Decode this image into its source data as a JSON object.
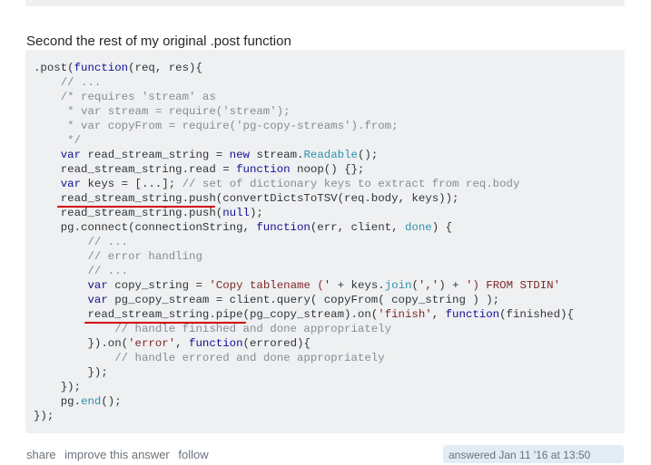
{
  "intro_text": "Second the rest of my original .post function",
  "code_lines": [
    [
      {
        "t": ".post(",
        "c": "p"
      },
      {
        "t": "function",
        "c": "kw"
      },
      {
        "t": "(req, res){",
        "c": "p"
      }
    ],
    [
      {
        "t": "    ",
        "c": "p"
      },
      {
        "t": "// ...",
        "c": "com"
      }
    ],
    [
      {
        "t": "    ",
        "c": "p"
      },
      {
        "t": "/* requires 'stream' as",
        "c": "com"
      }
    ],
    [
      {
        "t": "     * var stream = require('stream');",
        "c": "com"
      }
    ],
    [
      {
        "t": "     * var copyFrom = require('pg-copy-streams').from;",
        "c": "com"
      }
    ],
    [
      {
        "t": "     */",
        "c": "com"
      }
    ],
    [
      {
        "t": "    ",
        "c": "p"
      },
      {
        "t": "var",
        "c": "kw"
      },
      {
        "t": " read_stream_string = ",
        "c": "p"
      },
      {
        "t": "new",
        "c": "kw"
      },
      {
        "t": " stream.",
        "c": "p"
      },
      {
        "t": "Readable",
        "c": "ty"
      },
      {
        "t": "();",
        "c": "p"
      }
    ],
    [
      {
        "t": "    read_stream_string.read = ",
        "c": "p"
      },
      {
        "t": "function",
        "c": "kw"
      },
      {
        "t": " noop() {};",
        "c": "p"
      }
    ],
    [
      {
        "t": "    ",
        "c": "p"
      },
      {
        "t": "var",
        "c": "kw"
      },
      {
        "t": " keys = [...]; ",
        "c": "p"
      },
      {
        "t": "// set of dictionary keys to extract from req.body",
        "c": "com"
      }
    ],
    [
      {
        "t": "    read_stream_string.push(convertDictsToTSV(req.body, keys));",
        "c": "p"
      }
    ],
    [
      {
        "t": "    read_stream_string.push(",
        "c": "p"
      },
      {
        "t": "null",
        "c": "kw"
      },
      {
        "t": ");",
        "c": "p"
      }
    ],
    [
      {
        "t": "    pg.connect(connectionString, ",
        "c": "p"
      },
      {
        "t": "function",
        "c": "kw"
      },
      {
        "t": "(err, client, ",
        "c": "p"
      },
      {
        "t": "done",
        "c": "fn"
      },
      {
        "t": ") {",
        "c": "p"
      }
    ],
    [
      {
        "t": "        ",
        "c": "p"
      },
      {
        "t": "// ...",
        "c": "com"
      }
    ],
    [
      {
        "t": "        ",
        "c": "p"
      },
      {
        "t": "// error handling",
        "c": "com"
      }
    ],
    [
      {
        "t": "        ",
        "c": "p"
      },
      {
        "t": "// ...",
        "c": "com"
      }
    ],
    [
      {
        "t": "        ",
        "c": "p"
      },
      {
        "t": "var",
        "c": "kw"
      },
      {
        "t": " copy_string = ",
        "c": "p"
      },
      {
        "t": "'Copy tablename ('",
        "c": "str"
      },
      {
        "t": " + keys.",
        "c": "p"
      },
      {
        "t": "join",
        "c": "fn"
      },
      {
        "t": "(",
        "c": "p"
      },
      {
        "t": "','",
        "c": "str"
      },
      {
        "t": ") + ",
        "c": "p"
      },
      {
        "t": "') FROM STDIN'",
        "c": "str"
      }
    ],
    [
      {
        "t": "        ",
        "c": "p"
      },
      {
        "t": "var",
        "c": "kw"
      },
      {
        "t": " pg_copy_stream = client.query( copyFrom( copy_string ) );",
        "c": "p"
      }
    ],
    [
      {
        "t": "        read_stream_string.pipe(pg_copy_stream).on(",
        "c": "p"
      },
      {
        "t": "'finish'",
        "c": "str"
      },
      {
        "t": ", ",
        "c": "p"
      },
      {
        "t": "function",
        "c": "kw"
      },
      {
        "t": "(finished){",
        "c": "p"
      }
    ],
    [
      {
        "t": "            ",
        "c": "p"
      },
      {
        "t": "// handle finished and done appropriately",
        "c": "com"
      }
    ],
    [
      {
        "t": "        }).on(",
        "c": "p"
      },
      {
        "t": "'error'",
        "c": "str"
      },
      {
        "t": ", ",
        "c": "p"
      },
      {
        "t": "function",
        "c": "kw"
      },
      {
        "t": "(errored){",
        "c": "p"
      }
    ],
    [
      {
        "t": "            ",
        "c": "p"
      },
      {
        "t": "// handle errored and done appropriately",
        "c": "com"
      }
    ],
    [
      {
        "t": "        });",
        "c": "p"
      }
    ],
    [
      {
        "t": "    });",
        "c": "p"
      }
    ],
    [
      {
        "t": "    pg.",
        "c": "p"
      },
      {
        "t": "end",
        "c": "fn"
      },
      {
        "t": "();",
        "c": "p"
      }
    ],
    [
      {
        "t": "});",
        "c": "p"
      }
    ]
  ],
  "footer_links": [
    "share",
    "improve this answer",
    "follow"
  ],
  "answered_text": "answered Jan 11 '16 at 13:50",
  "colors": {
    "code_bg": "#eff0f1",
    "underline": "#d0000a",
    "keyword": "#101094",
    "comment": "#858c93",
    "string": "#7d2727"
  }
}
